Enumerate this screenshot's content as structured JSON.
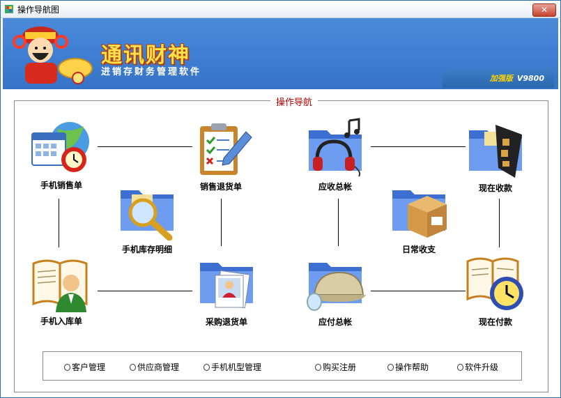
{
  "window": {
    "title": "操作导航图",
    "close_symbol": "✕"
  },
  "banner": {
    "title": "通讯财神",
    "subtitle": "进销存财务管理软件",
    "edition_label": "加强版",
    "version": "V9800"
  },
  "nav": {
    "legend": "操作导航",
    "items": [
      {
        "label": "手机销售单",
        "icon": "calendar-clock-icon"
      },
      {
        "label": "销售退货单",
        "icon": "clipboard-checklist-icon"
      },
      {
        "label": "应收总帐",
        "icon": "folder-headphones-icon"
      },
      {
        "label": "现在收款",
        "icon": "folder-film-icon"
      },
      {
        "label": "手机库存明细",
        "icon": "folder-magnifier-icon"
      },
      {
        "label": "日常收支",
        "icon": "folder-box-icon"
      },
      {
        "label": "手机入库单",
        "icon": "book-user-icon"
      },
      {
        "label": "采购退货单",
        "icon": "folder-photos-icon"
      },
      {
        "label": "应付总帐",
        "icon": "folder-helmet-icon"
      },
      {
        "label": "现在付款",
        "icon": "book-clock-icon"
      }
    ]
  },
  "links": [
    "客户管理",
    "供应商管理",
    "手机机型管理",
    "购买注册",
    "操作帮助",
    "软件升级"
  ]
}
